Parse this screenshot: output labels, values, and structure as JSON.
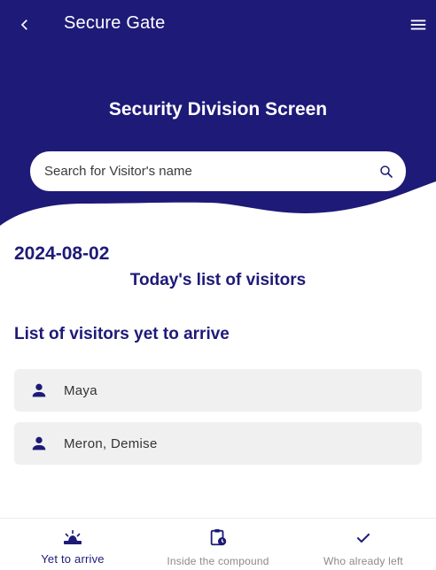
{
  "app_bar": {
    "title": "Secure Gate",
    "back_icon": "chevron-left-icon",
    "menu_icon": "menu-icon"
  },
  "header": {
    "screen_title": "Security Division Screen"
  },
  "search": {
    "placeholder": "Search for Visitor's name",
    "icon": "search-icon"
  },
  "main": {
    "date": "2024-08-02",
    "list_heading": "Today's list of visitors",
    "section_heading": "List of visitors yet to arrive",
    "visitors": [
      {
        "name": "Maya",
        "icon": "person-icon"
      },
      {
        "name": "Meron, Demise",
        "icon": "person-icon"
      }
    ]
  },
  "bottom_nav": {
    "items": [
      {
        "label": "Yet to arrive",
        "icon": "arrival-icon",
        "active": true
      },
      {
        "label": "Inside the compound",
        "icon": "clipboard-clock-icon",
        "active": false
      },
      {
        "label": "Who already left",
        "icon": "check-icon",
        "active": false
      }
    ]
  },
  "colors": {
    "primary": "#1e1a78",
    "white": "#ffffff",
    "card_bg": "#f0f0f0",
    "inactive": "#8a8a8a"
  }
}
